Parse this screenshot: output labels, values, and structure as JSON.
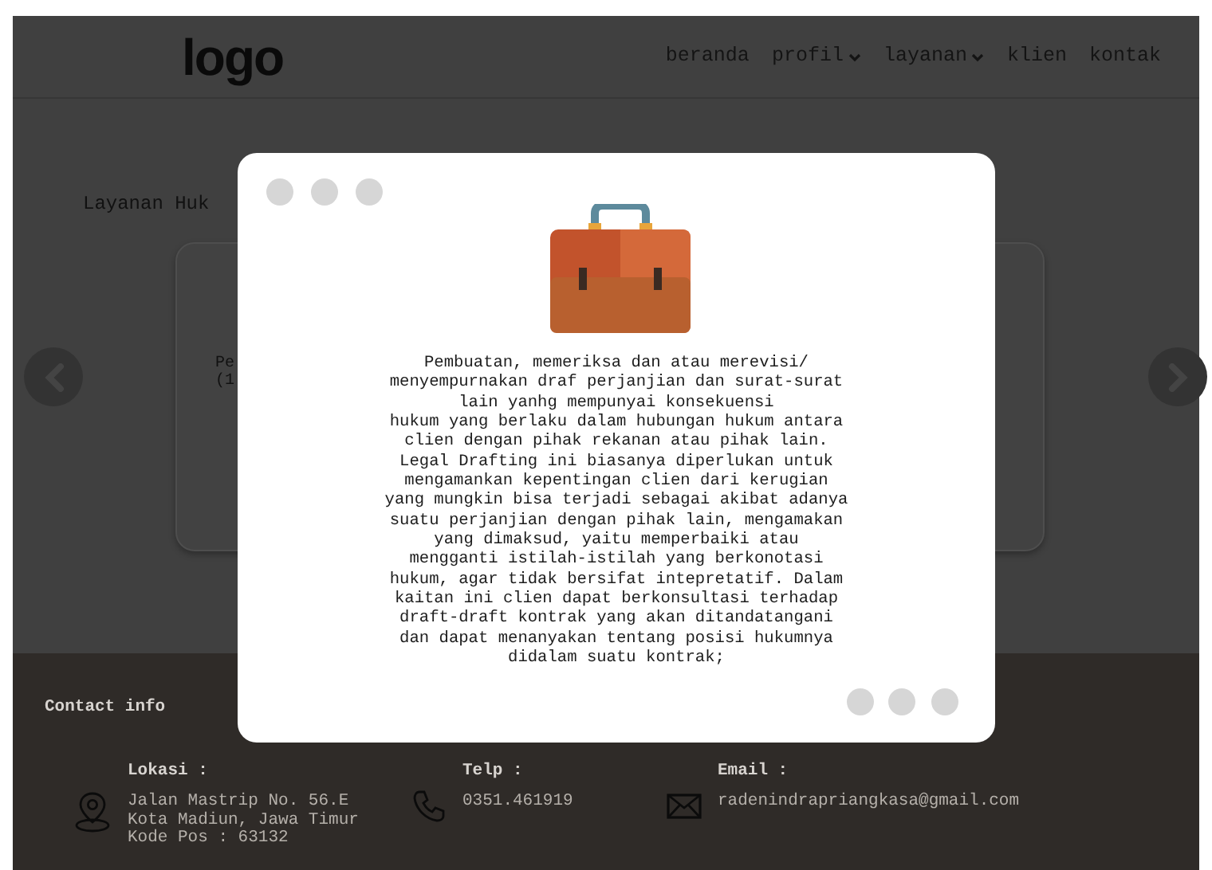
{
  "navbar": {
    "logo": "logo",
    "items": [
      {
        "label": "beranda",
        "dropdown": false
      },
      {
        "label": "profil",
        "dropdown": true
      },
      {
        "label": "layanan",
        "dropdown": true
      },
      {
        "label": "klien",
        "dropdown": false
      },
      {
        "label": "kontak",
        "dropdown": false
      }
    ]
  },
  "section": {
    "title": "Layanan Huk",
    "card_lines": [
      "Pe",
      "(1"
    ]
  },
  "modal": {
    "description_lines": [
      "Pembuatan, memeriksa dan atau merevisi/",
      "menyempurnakan draf perjanjian dan surat-surat",
      "lain yanhg mempunyai konsekuensi",
      "hukum yang berlaku dalam hubungan hukum antara",
      "clien dengan pihak rekanan atau pihak lain.",
      "Legal Drafting ini biasanya diperlukan untuk",
      "mengamankan kepentingan clien dari kerugian",
      "yang mungkin bisa terjadi sebagai akibat adanya",
      "suatu perjanjian dengan pihak lain, mengamakan",
      "yang dimaksud, yaitu memperbaiki atau",
      "mengganti istilah-istilah yang berkonotasi",
      "hukum, agar tidak bersifat intepretatif. Dalam",
      "kaitan ini clien dapat berkonsultasi terhadap",
      "draft-draft kontrak yang akan ditandatangani",
      "dan dapat menanyakan tentang posisi hukumnya",
      "didalam suatu kontrak;"
    ]
  },
  "footer": {
    "heading": "Contact info",
    "items": [
      {
        "kind": "location",
        "label": "Lokasi :",
        "value_lines": [
          "Jalan Mastrip No. 56.E",
          "Kota Madiun, Jawa Timur",
          "Kode Pos : 63132"
        ]
      },
      {
        "kind": "phone",
        "label": "Telp :",
        "value_lines": [
          "0351.461919"
        ]
      },
      {
        "kind": "email",
        "label": "Email :",
        "value_lines": [
          "radenindrapriangkasa@gmail.com"
        ]
      }
    ]
  }
}
